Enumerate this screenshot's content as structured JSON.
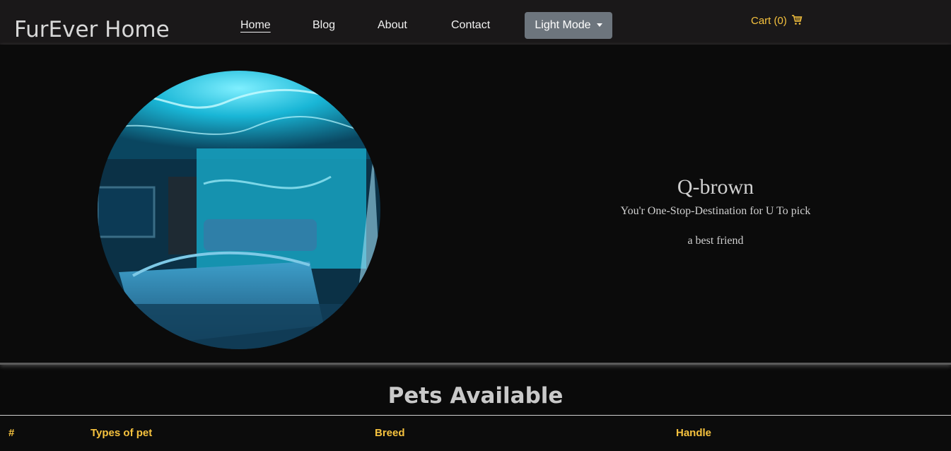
{
  "brand": "FurEver Home",
  "nav": {
    "home": "Home",
    "blog": "Blog",
    "about": "About",
    "contact": "Contact",
    "mode_button": "Light Mode",
    "cart": "Cart (0)"
  },
  "hero": {
    "image_icon": "bedroom-photo",
    "title": "Q-brown",
    "line1": "You'r One-Stop-Destination for U To pick",
    "line2": "a best friend"
  },
  "section": {
    "title": "Pets Available"
  },
  "table": {
    "headers": [
      "#",
      "Types of pet",
      "Breed",
      "Handle"
    ]
  },
  "colors": {
    "accent": "#f6c23e",
    "navbar": "#1a1819",
    "button": "#6d757d",
    "background": "#0a0a0a"
  }
}
